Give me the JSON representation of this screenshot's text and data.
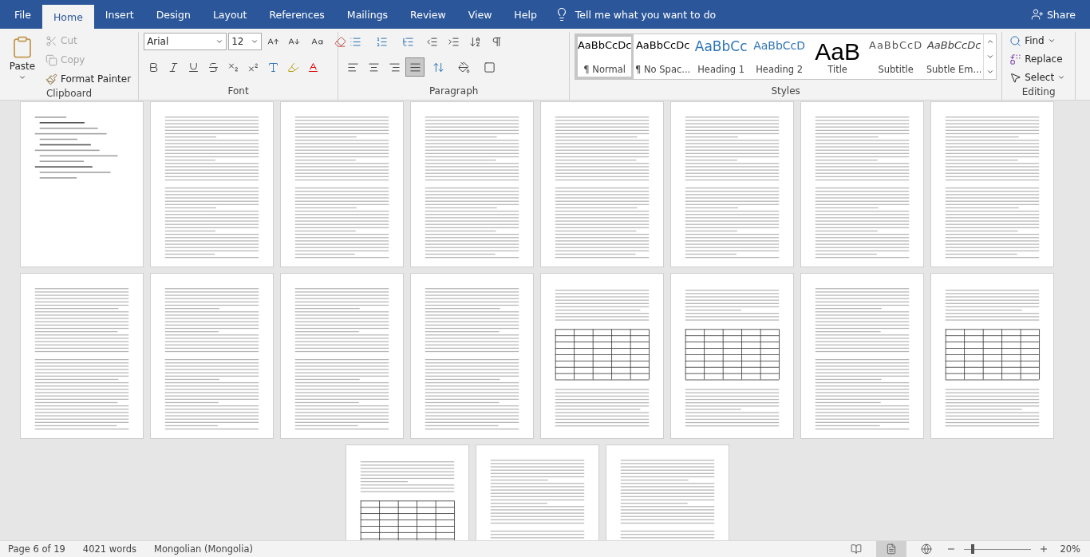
{
  "tabs": [
    {
      "label": "File",
      "selected": false
    },
    {
      "label": "Home",
      "selected": true
    },
    {
      "label": "Insert",
      "selected": false
    },
    {
      "label": "Design",
      "selected": false
    },
    {
      "label": "Layout",
      "selected": false
    },
    {
      "label": "References",
      "selected": false
    },
    {
      "label": "Mailings",
      "selected": false
    },
    {
      "label": "Review",
      "selected": false
    },
    {
      "label": "View",
      "selected": false
    },
    {
      "label": "Help",
      "selected": false
    }
  ],
  "tell_me": "Tell me what you want to do",
  "share": "Share",
  "clipboard": {
    "label": "Clipboard",
    "paste": "Paste",
    "cut": {
      "label": "Cut",
      "disabled": true
    },
    "copy": {
      "label": "Copy",
      "disabled": true
    },
    "format_painter": "Format Painter"
  },
  "font": {
    "label": "Font",
    "family": "Arial",
    "size": "12"
  },
  "paragraph": {
    "label": "Paragraph",
    "alignments": [
      {
        "kind": "left",
        "selected": false
      },
      {
        "kind": "center",
        "selected": false
      },
      {
        "kind": "right",
        "selected": false
      },
      {
        "kind": "justify",
        "selected": true
      }
    ]
  },
  "styles": {
    "label": "Styles",
    "items": [
      {
        "kind": "normal",
        "preview": "AaBbCcDc",
        "name": "¶ Normal",
        "selected": true
      },
      {
        "kind": "normal",
        "preview": "AaBbCcDc",
        "name": "¶ No Spac...",
        "selected": false
      },
      {
        "kind": "heading1",
        "preview": "AaBbCc",
        "name": "Heading 1",
        "selected": false
      },
      {
        "kind": "heading2",
        "preview": "AaBbCcD",
        "name": "Heading 2",
        "selected": false
      },
      {
        "kind": "title",
        "preview": "AaB",
        "name": "Title",
        "selected": false
      },
      {
        "kind": "subtitle",
        "preview": "AaBbCcD",
        "name": "Subtitle",
        "selected": false
      },
      {
        "kind": "emphasis",
        "preview": "AaBbCcDc",
        "name": "Subtle Em...",
        "selected": false
      }
    ]
  },
  "editing": {
    "label": "Editing",
    "find": "Find",
    "replace": "Replace",
    "select": "Select"
  },
  "pages": [
    {
      "kind": "contents"
    },
    {
      "kind": "text"
    },
    {
      "kind": "text"
    },
    {
      "kind": "text"
    },
    {
      "kind": "text"
    },
    {
      "kind": "text"
    },
    {
      "kind": "text"
    },
    {
      "kind": "text"
    },
    {
      "kind": "text"
    },
    {
      "kind": "text"
    },
    {
      "kind": "text"
    },
    {
      "kind": "text"
    },
    {
      "kind": "table"
    },
    {
      "kind": "table"
    },
    {
      "kind": "text"
    },
    {
      "kind": "table"
    },
    {
      "kind": "table"
    },
    {
      "kind": "text"
    },
    {
      "kind": "text"
    }
  ],
  "status_bar": {
    "page": "Page 6 of 19",
    "words": "4021 words",
    "language": "Mongolian (Mongolia)",
    "views": [
      {
        "kind": "read",
        "selected": false
      },
      {
        "kind": "print",
        "selected": true
      },
      {
        "kind": "web",
        "selected": false
      }
    ],
    "zoom": {
      "level": 0.12,
      "reading": "20%"
    }
  }
}
